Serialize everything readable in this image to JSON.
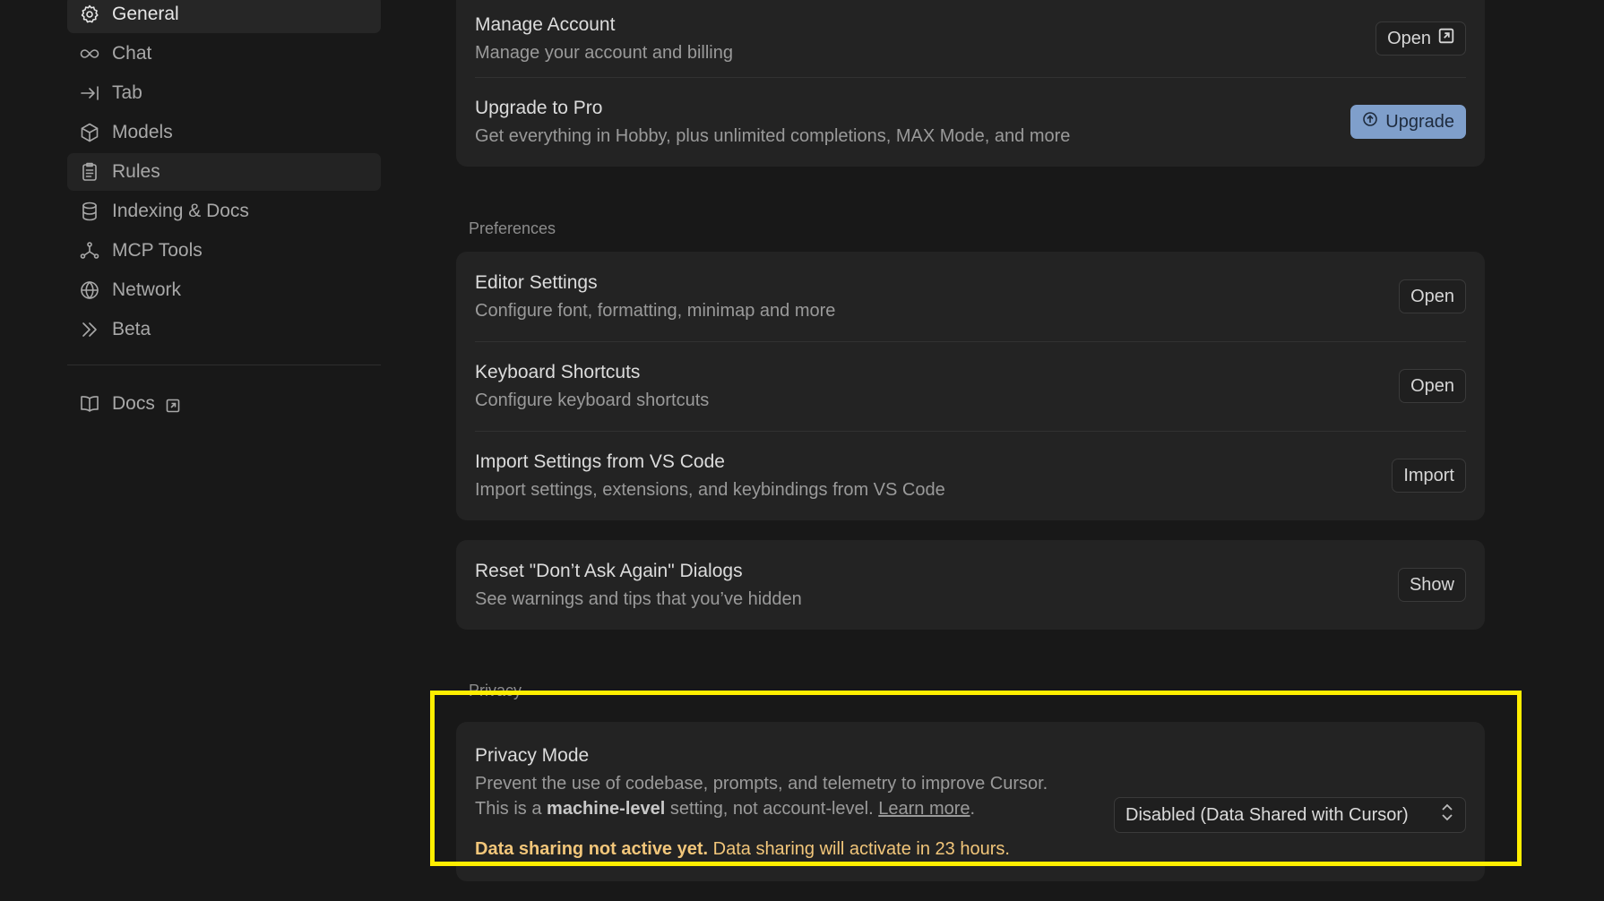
{
  "sidebar": {
    "items": [
      {
        "label": "General",
        "icon": "gear-icon"
      },
      {
        "label": "Chat",
        "icon": "infinity-icon"
      },
      {
        "label": "Tab",
        "icon": "arrow-right-bar-icon"
      },
      {
        "label": "Models",
        "icon": "cube-icon"
      },
      {
        "label": "Rules",
        "icon": "clipboard-icon"
      },
      {
        "label": "Indexing & Docs",
        "icon": "database-icon"
      },
      {
        "label": "MCP Tools",
        "icon": "network-node-icon"
      },
      {
        "label": "Network",
        "icon": "globe-icon"
      },
      {
        "label": "Beta",
        "icon": "double-chevron-icon"
      }
    ],
    "docs_label": "Docs"
  },
  "account": {
    "manage": {
      "title": "Manage Account",
      "desc": "Manage your account and billing",
      "button": "Open"
    },
    "upgrade": {
      "title": "Upgrade to Pro",
      "desc": "Get everything in Hobby, plus unlimited completions, MAX Mode, and more",
      "button": "Upgrade"
    }
  },
  "preferences": {
    "label": "Preferences",
    "editor": {
      "title": "Editor Settings",
      "desc": "Configure font, formatting, minimap and more",
      "button": "Open"
    },
    "keyboard": {
      "title": "Keyboard Shortcuts",
      "desc": "Configure keyboard shortcuts",
      "button": "Open"
    },
    "import": {
      "title": "Import Settings from VS Code",
      "desc": "Import settings, extensions, and keybindings from VS Code",
      "button": "Import"
    },
    "reset": {
      "title": "Reset \"Don’t Ask Again\" Dialogs",
      "desc": "See warnings and tips that you’ve hidden",
      "button": "Show"
    }
  },
  "privacy": {
    "label": "Privacy",
    "title": "Privacy Mode",
    "desc_line1": "Prevent the use of codebase, prompts, and telemetry to improve Cursor.",
    "desc_line2_prefix": "This is a ",
    "desc_line2_bold": "machine-level",
    "desc_line2_suffix": " setting, not account-level. ",
    "learn_more": "Learn more",
    "period": ".",
    "select_value": "Disabled (Data Shared with Cursor)",
    "warning_bold": "Data sharing not active yet.",
    "warning_text": " Data sharing will activate in 23 hours."
  },
  "colors": {
    "accent": "#7f9fcb",
    "warning": "#f2c67a",
    "highlight": "#ffee00"
  }
}
